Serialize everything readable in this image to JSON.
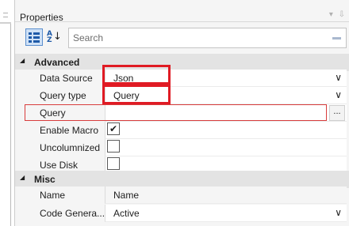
{
  "panel": {
    "title": "Properties",
    "title_controls": "▾ ⇩"
  },
  "toolbar": {
    "categorized_icon": "categorized-view-icon",
    "alphabetical_icon": "sort-alphabetical-icon",
    "search": {
      "placeholder": "Search",
      "value": ""
    }
  },
  "categories": [
    {
      "label": "Advanced",
      "properties": [
        {
          "name": "Data Source",
          "value": "Json",
          "editor": "dropdown"
        },
        {
          "name": "Query type",
          "value": "Query",
          "editor": "dropdown"
        },
        {
          "name": "Query",
          "value": "",
          "editor": "ellipsis",
          "button_label": "..."
        },
        {
          "name": "Enable Macro",
          "value": "true",
          "editor": "checkbox",
          "mark": "✔"
        },
        {
          "name": "Uncolumnized",
          "value": "false",
          "editor": "checkbox"
        },
        {
          "name": "Use Disk",
          "value": "false",
          "editor": "checkbox"
        }
      ]
    },
    {
      "label": "Misc",
      "properties": [
        {
          "name": "Name",
          "value": "Name",
          "editor": "text"
        },
        {
          "name": "Code Genera...",
          "value": "Active",
          "editor": "dropdown"
        }
      ]
    }
  ],
  "glyphs": {
    "collapse": "◢",
    "dropdown": "∨"
  },
  "colors": {
    "highlight": "#e01b24",
    "selected_toolbar": "#cfe1f6",
    "category_band": "#e3e3e3"
  }
}
